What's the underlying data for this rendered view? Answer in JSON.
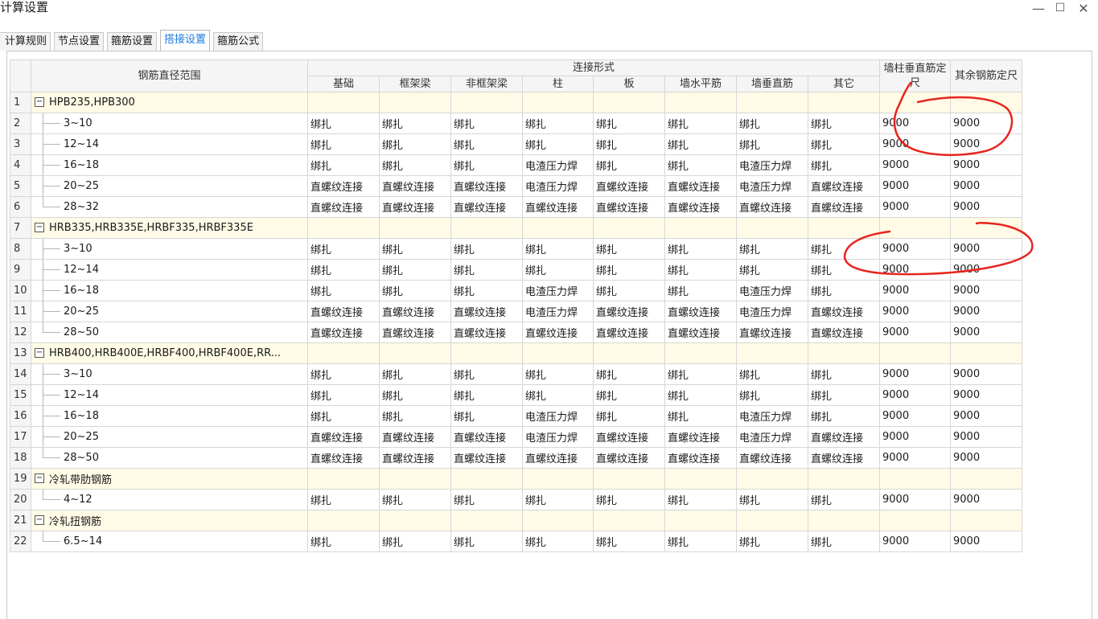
{
  "window": {
    "title": "计算设置",
    "controls": {
      "minimize": "—",
      "maximize": "☐",
      "close": "✕"
    }
  },
  "tabs": [
    {
      "label": "计算规则",
      "active": false
    },
    {
      "label": "节点设置",
      "active": false
    },
    {
      "label": "箍筋设置",
      "active": false
    },
    {
      "label": "搭接设置",
      "active": true
    },
    {
      "label": "箍筋公式",
      "active": false
    }
  ],
  "table": {
    "header": {
      "range": "钢筋直径范围",
      "connection_group": "连接形式",
      "connection_cols": [
        "基础",
        "框架梁",
        "非框架梁",
        "柱",
        "板",
        "墙水平筋",
        "墙垂直筋",
        "其它"
      ],
      "wall_fixed": "墙柱垂直筋定尺",
      "other_fixed": "其余钢筋定尺"
    },
    "rows": [
      {
        "num": "1",
        "type": "group",
        "label": "HPB235,HPB300"
      },
      {
        "num": "2",
        "type": "item",
        "range": "3~10",
        "cells": [
          "绑扎",
          "绑扎",
          "绑扎",
          "绑扎",
          "绑扎",
          "绑扎",
          "绑扎",
          "绑扎",
          "9000",
          "9000"
        ]
      },
      {
        "num": "3",
        "type": "item",
        "range": "12~14",
        "cells": [
          "绑扎",
          "绑扎",
          "绑扎",
          "绑扎",
          "绑扎",
          "绑扎",
          "绑扎",
          "绑扎",
          "9000",
          "9000"
        ]
      },
      {
        "num": "4",
        "type": "item",
        "range": "16~18",
        "cells": [
          "绑扎",
          "绑扎",
          "绑扎",
          "电渣压力焊",
          "绑扎",
          "绑扎",
          "电渣压力焊",
          "绑扎",
          "9000",
          "9000"
        ]
      },
      {
        "num": "5",
        "type": "item",
        "range": "20~25",
        "cells": [
          "直螺纹连接",
          "直螺纹连接",
          "直螺纹连接",
          "电渣压力焊",
          "直螺纹连接",
          "直螺纹连接",
          "电渣压力焊",
          "直螺纹连接",
          "9000",
          "9000"
        ]
      },
      {
        "num": "6",
        "type": "item",
        "range": "28~32",
        "last": true,
        "cells": [
          "直螺纹连接",
          "直螺纹连接",
          "直螺纹连接",
          "直螺纹连接",
          "直螺纹连接",
          "直螺纹连接",
          "直螺纹连接",
          "直螺纹连接",
          "9000",
          "9000"
        ]
      },
      {
        "num": "7",
        "type": "group",
        "label": "HRB335,HRB335E,HRBF335,HRBF335E"
      },
      {
        "num": "8",
        "type": "item",
        "range": "3~10",
        "cells": [
          "绑扎",
          "绑扎",
          "绑扎",
          "绑扎",
          "绑扎",
          "绑扎",
          "绑扎",
          "绑扎",
          "9000",
          "9000"
        ]
      },
      {
        "num": "9",
        "type": "item",
        "range": "12~14",
        "cells": [
          "绑扎",
          "绑扎",
          "绑扎",
          "绑扎",
          "绑扎",
          "绑扎",
          "绑扎",
          "绑扎",
          "9000",
          "9000"
        ]
      },
      {
        "num": "10",
        "type": "item",
        "range": "16~18",
        "cells": [
          "绑扎",
          "绑扎",
          "绑扎",
          "电渣压力焊",
          "绑扎",
          "绑扎",
          "电渣压力焊",
          "绑扎",
          "9000",
          "9000"
        ]
      },
      {
        "num": "11",
        "type": "item",
        "range": "20~25",
        "cells": [
          "直螺纹连接",
          "直螺纹连接",
          "直螺纹连接",
          "电渣压力焊",
          "直螺纹连接",
          "直螺纹连接",
          "电渣压力焊",
          "直螺纹连接",
          "9000",
          "9000"
        ]
      },
      {
        "num": "12",
        "type": "item",
        "range": "28~50",
        "last": true,
        "cells": [
          "直螺纹连接",
          "直螺纹连接",
          "直螺纹连接",
          "直螺纹连接",
          "直螺纹连接",
          "直螺纹连接",
          "直螺纹连接",
          "直螺纹连接",
          "9000",
          "9000"
        ]
      },
      {
        "num": "13",
        "type": "group",
        "label": "HRB400,HRB400E,HRBF400,HRBF400E,RR..."
      },
      {
        "num": "14",
        "type": "item",
        "range": "3~10",
        "cells": [
          "绑扎",
          "绑扎",
          "绑扎",
          "绑扎",
          "绑扎",
          "绑扎",
          "绑扎",
          "绑扎",
          "9000",
          "9000"
        ]
      },
      {
        "num": "15",
        "type": "item",
        "range": "12~14",
        "cells": [
          "绑扎",
          "绑扎",
          "绑扎",
          "绑扎",
          "绑扎",
          "绑扎",
          "绑扎",
          "绑扎",
          "9000",
          "9000"
        ]
      },
      {
        "num": "16",
        "type": "item",
        "range": "16~18",
        "cells": [
          "绑扎",
          "绑扎",
          "绑扎",
          "电渣压力焊",
          "绑扎",
          "绑扎",
          "电渣压力焊",
          "绑扎",
          "9000",
          "9000"
        ]
      },
      {
        "num": "17",
        "type": "item",
        "range": "20~25",
        "cells": [
          "直螺纹连接",
          "直螺纹连接",
          "直螺纹连接",
          "电渣压力焊",
          "直螺纹连接",
          "直螺纹连接",
          "电渣压力焊",
          "直螺纹连接",
          "9000",
          "9000"
        ]
      },
      {
        "num": "18",
        "type": "item",
        "range": "28~50",
        "last": true,
        "cells": [
          "直螺纹连接",
          "直螺纹连接",
          "直螺纹连接",
          "直螺纹连接",
          "直螺纹连接",
          "直螺纹连接",
          "直螺纹连接",
          "直螺纹连接",
          "9000",
          "9000"
        ]
      },
      {
        "num": "19",
        "type": "group",
        "label": "冷轧带肋钢筋"
      },
      {
        "num": "20",
        "type": "item",
        "range": "4~12",
        "last": true,
        "cells": [
          "绑扎",
          "绑扎",
          "绑扎",
          "绑扎",
          "绑扎",
          "绑扎",
          "绑扎",
          "绑扎",
          "9000",
          "9000"
        ]
      },
      {
        "num": "21",
        "type": "group",
        "label": "冷轧扭钢筋"
      },
      {
        "num": "22",
        "type": "item",
        "range": "6.5~14",
        "last": true,
        "cells": [
          "绑扎",
          "绑扎",
          "绑扎",
          "绑扎",
          "绑扎",
          "绑扎",
          "绑扎",
          "绑扎",
          "9000",
          "9000"
        ]
      }
    ]
  },
  "annotation": {
    "color": "#e8251f"
  }
}
